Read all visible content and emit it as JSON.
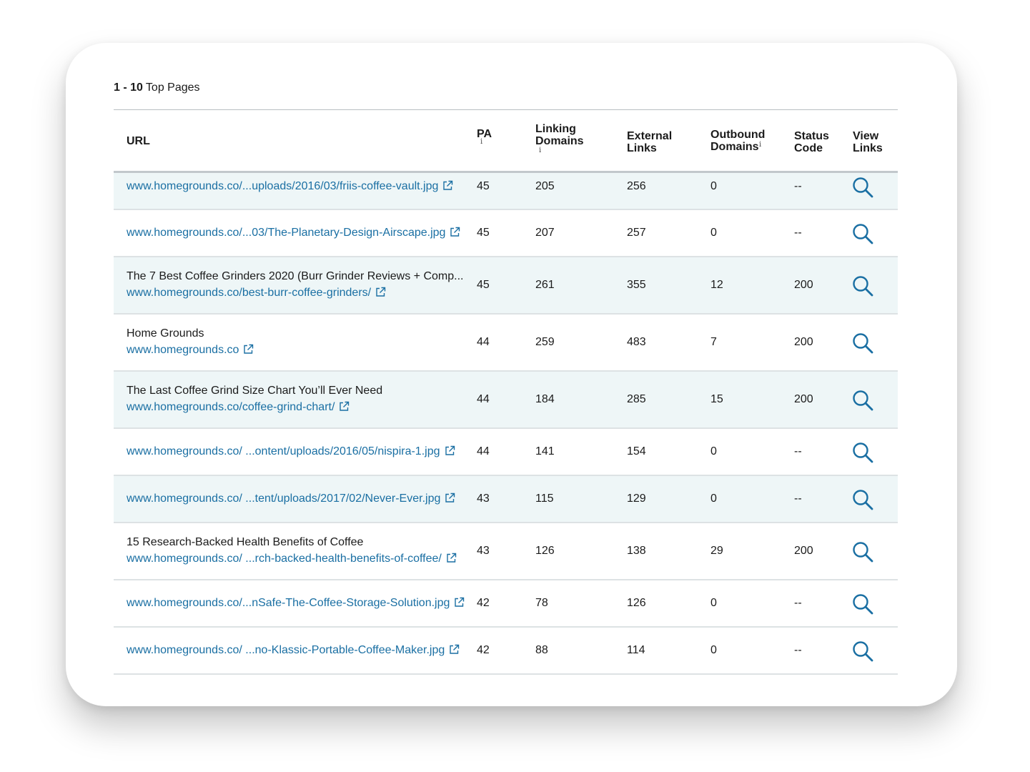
{
  "header": {
    "range": "1 - 10",
    "label": "Top Pages"
  },
  "columns": {
    "url": "URL",
    "pa": "PA",
    "linking_line1": "Linking",
    "linking_line2": "Domains",
    "external_line1": "External",
    "external_line2": "Links",
    "outbound_line1": "Outbound",
    "outbound_line2": "Domains",
    "status_line1": "Status",
    "status_line2": "Code",
    "view_line1": "View",
    "view_line2": "Links",
    "info_glyph": "i"
  },
  "colors": {
    "link": "#1a6fa3",
    "alt_row": "#eef6f7",
    "sort_active": "#1c3b5a",
    "sort_inactive": "#4a90c2"
  },
  "rows": [
    {
      "title": "",
      "url": "www.homegrounds.co/...uploads/2016/03/friis-coffee-vault.jpg",
      "pa": "45",
      "linking": "205",
      "external": "256",
      "outbound": "0",
      "status": "--"
    },
    {
      "title": "",
      "url": "www.homegrounds.co/...03/The-Planetary-Design-Airscape.jpg",
      "pa": "45",
      "linking": "207",
      "external": "257",
      "outbound": "0",
      "status": "--"
    },
    {
      "title": "The 7 Best Coffee Grinders 2020 (Burr Grinder Reviews + Comp...",
      "url": "www.homegrounds.co/best-burr-coffee-grinders/",
      "pa": "45",
      "linking": "261",
      "external": "355",
      "outbound": "12",
      "status": "200"
    },
    {
      "title": "Home Grounds",
      "url": "www.homegrounds.co",
      "pa": "44",
      "linking": "259",
      "external": "483",
      "outbound": "7",
      "status": "200"
    },
    {
      "title": "The Last Coffee Grind Size Chart You’ll Ever Need",
      "url": "www.homegrounds.co/coffee-grind-chart/",
      "pa": "44",
      "linking": "184",
      "external": "285",
      "outbound": "15",
      "status": "200"
    },
    {
      "title": "",
      "url": "www.homegrounds.co/ ...ontent/uploads/2016/05/nispira-1.jpg",
      "pa": "44",
      "linking": "141",
      "external": "154",
      "outbound": "0",
      "status": "--"
    },
    {
      "title": "",
      "url": "www.homegrounds.co/ ...tent/uploads/2017/02/Never-Ever.jpg",
      "pa": "43",
      "linking": "115",
      "external": "129",
      "outbound": "0",
      "status": "--"
    },
    {
      "title": "15 Research-Backed Health Benefits of Coffee",
      "url": "www.homegrounds.co/ ...rch-backed-health-benefits-of-coffee/",
      "pa": "43",
      "linking": "126",
      "external": "138",
      "outbound": "29",
      "status": "200"
    },
    {
      "title": "",
      "url": "www.homegrounds.co/...nSafe-The-Coffee-Storage-Solution.jpg",
      "pa": "42",
      "linking": "78",
      "external": "126",
      "outbound": "0",
      "status": "--"
    },
    {
      "title": "",
      "url": "www.homegrounds.co/ ...no-Klassic-Portable-Coffee-Maker.jpg",
      "pa": "42",
      "linking": "88",
      "external": "114",
      "outbound": "0",
      "status": "--"
    }
  ]
}
